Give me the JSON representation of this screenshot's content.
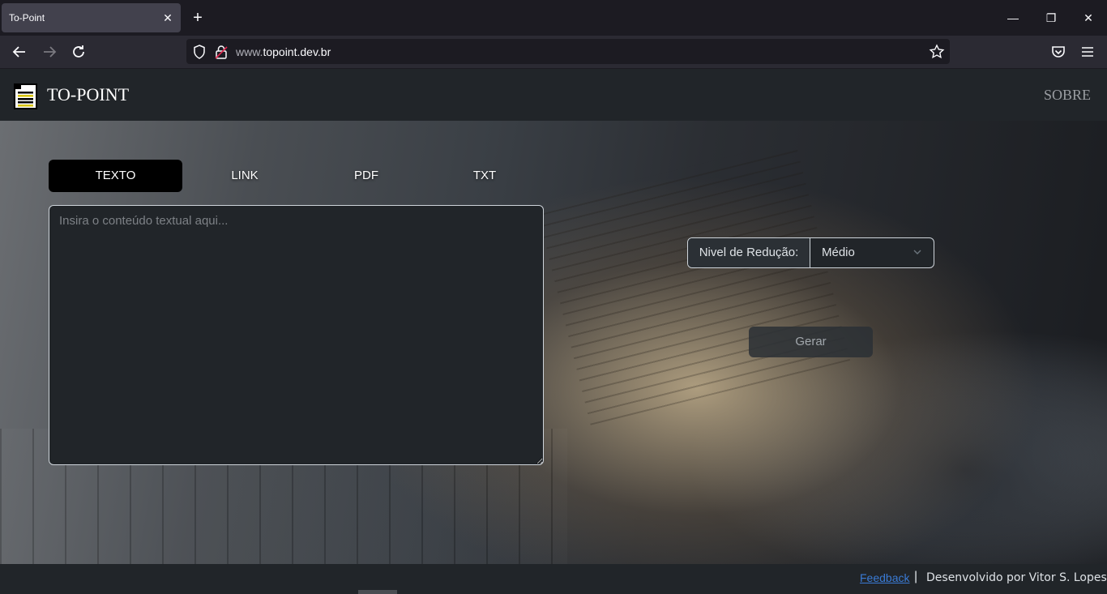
{
  "browser": {
    "tab_title": "To-Point",
    "tab_close": "✕",
    "new_tab": "+",
    "url_host": "www.topoint.dev.br",
    "url_prefix": "www.",
    "url_domain": "topoint.dev.br",
    "window": {
      "minimize": "—",
      "restore": "❐",
      "close": "✕"
    }
  },
  "header": {
    "brand": "TO-POINT",
    "nav_about": "SOBRE",
    "logo_icon": "document-icon"
  },
  "main": {
    "tabs": [
      {
        "label": "TEXTO",
        "active": true
      },
      {
        "label": "LINK",
        "active": false
      },
      {
        "label": "PDF",
        "active": false
      },
      {
        "label": "TXT",
        "active": false
      }
    ],
    "text_placeholder": "Insira o conteúdo textual aqui...",
    "level_label": "Nivel de Redução:",
    "level_value": "Médio",
    "generate_label": "Gerar"
  },
  "footer": {
    "feedback": "Feedback",
    "separator": "|",
    "credit": "Desenvolvido por Vitor S. Lopes"
  },
  "colors": {
    "header_bg": "#212529",
    "active_tab_bg": "#000000",
    "link": "#3a7bd5"
  }
}
